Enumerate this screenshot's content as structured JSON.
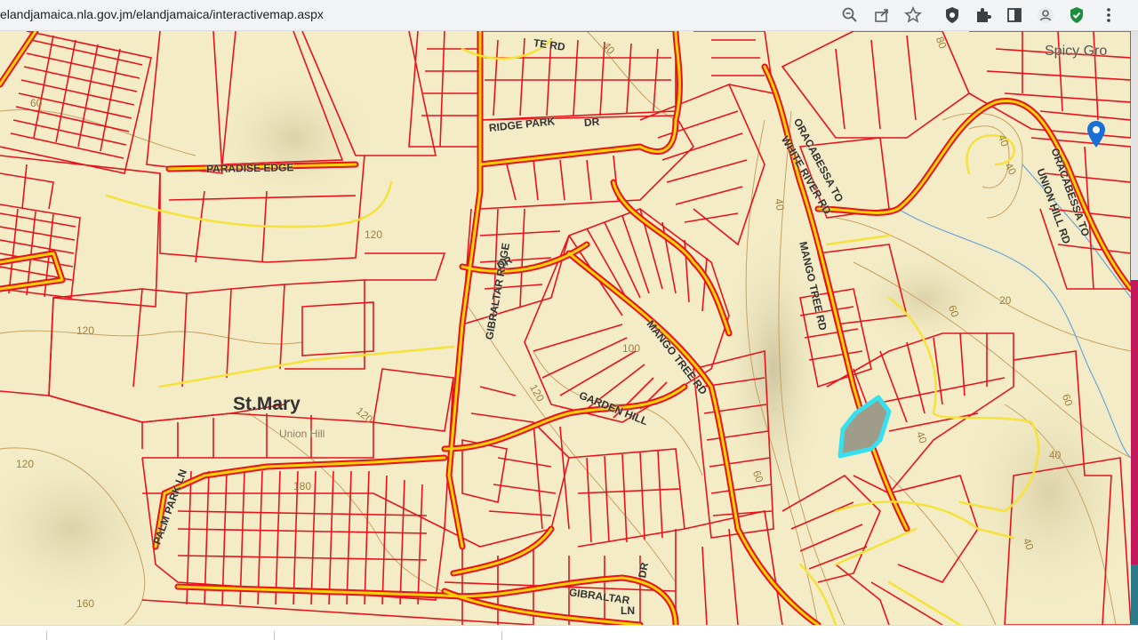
{
  "browser": {
    "url": "elandjamaica.nla.gov.jm/elandjamaica/interactivemap.aspx",
    "toolbar_icons": [
      "zoom-icon",
      "share-icon",
      "star-icon",
      "shield-extension-icon",
      "puzzle-extensions-icon",
      "sidepanel-icon",
      "profile-icon",
      "security-extension-icon",
      "menu-icon"
    ]
  },
  "map": {
    "parish_label": "St.Mary",
    "road_labels": {
      "paradise_edge": "PARADISE EDGE",
      "ridge_park": "RIDGE PARK",
      "ridge_park_dr": "DR",
      "top_rd": "TE RD",
      "oracabessa_white_river": "ORACABESSA TO",
      "white_river_rd": "WHITE RIVER RD",
      "oracabessa_union_hill": "ORACABESSA TO",
      "union_hill_rd": "UNION HILL RD",
      "mango_tree_rd_1": "MANGO TREE RD",
      "mango_tree_rd_2": "MANGO TREE RD",
      "gibraltar_ridge": "GIBRALTAR RIDGE",
      "gibraltar_ridge_dr": "DR",
      "garden_hill": "GARDEN HILL",
      "union_hill": "Union Hill",
      "palm_park_ln": "PALM PARK LN",
      "gibraltar_ln": "GIBRALTAR",
      "gibraltar_ln2": "LN",
      "gibraltar_ln_dr": "DR",
      "spicy_grove": "Spicy Gro"
    },
    "contour_labels": [
      "60",
      "120",
      "120",
      "160",
      "180",
      "120",
      "120",
      "120",
      "40",
      "40",
      "40",
      "40",
      "20",
      "60",
      "60",
      "40",
      "60",
      "40",
      "100",
      "40",
      "80"
    ],
    "colors": {
      "background": "#f3ecc6",
      "parcel": "#e8121b",
      "road": "#f5d400",
      "contour": "#c8a060",
      "highlight_fill": "#a09c8a",
      "highlight_outline": "#35e0f0"
    }
  }
}
